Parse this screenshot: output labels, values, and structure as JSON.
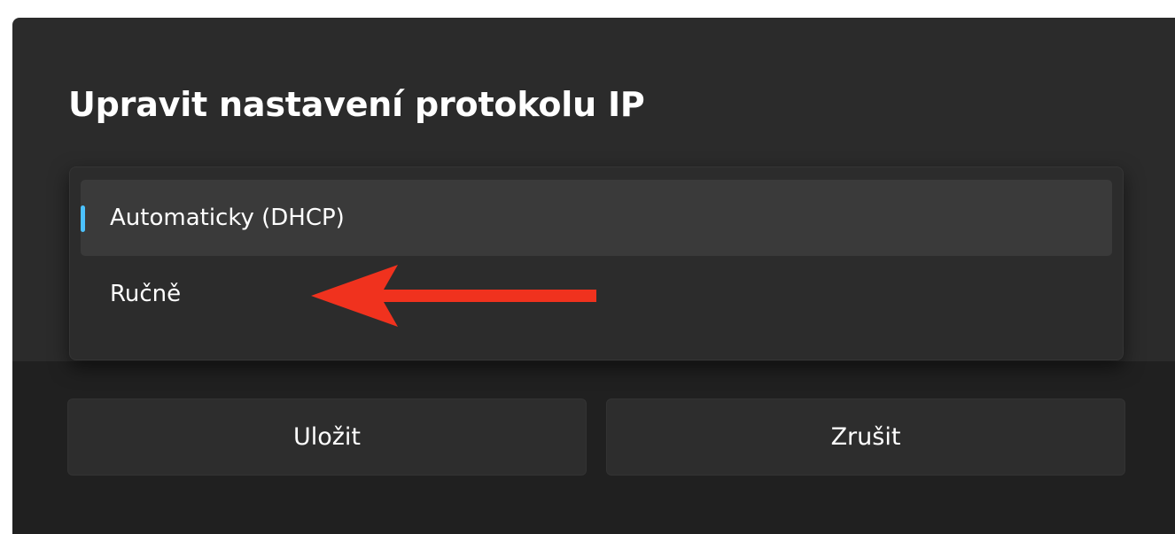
{
  "dialog": {
    "title": "Upravit nastavení protokolu IP"
  },
  "dropdown": {
    "options": [
      {
        "label": "Automaticky (DHCP)",
        "selected": true
      },
      {
        "label": "Ručně",
        "selected": false
      }
    ],
    "indicator_color": "#4cc2ff"
  },
  "annotation": {
    "icon": "red-arrow-icon",
    "color": "#f0321e"
  },
  "buttons": {
    "save_label": "Uložit",
    "cancel_label": "Zrušit"
  }
}
